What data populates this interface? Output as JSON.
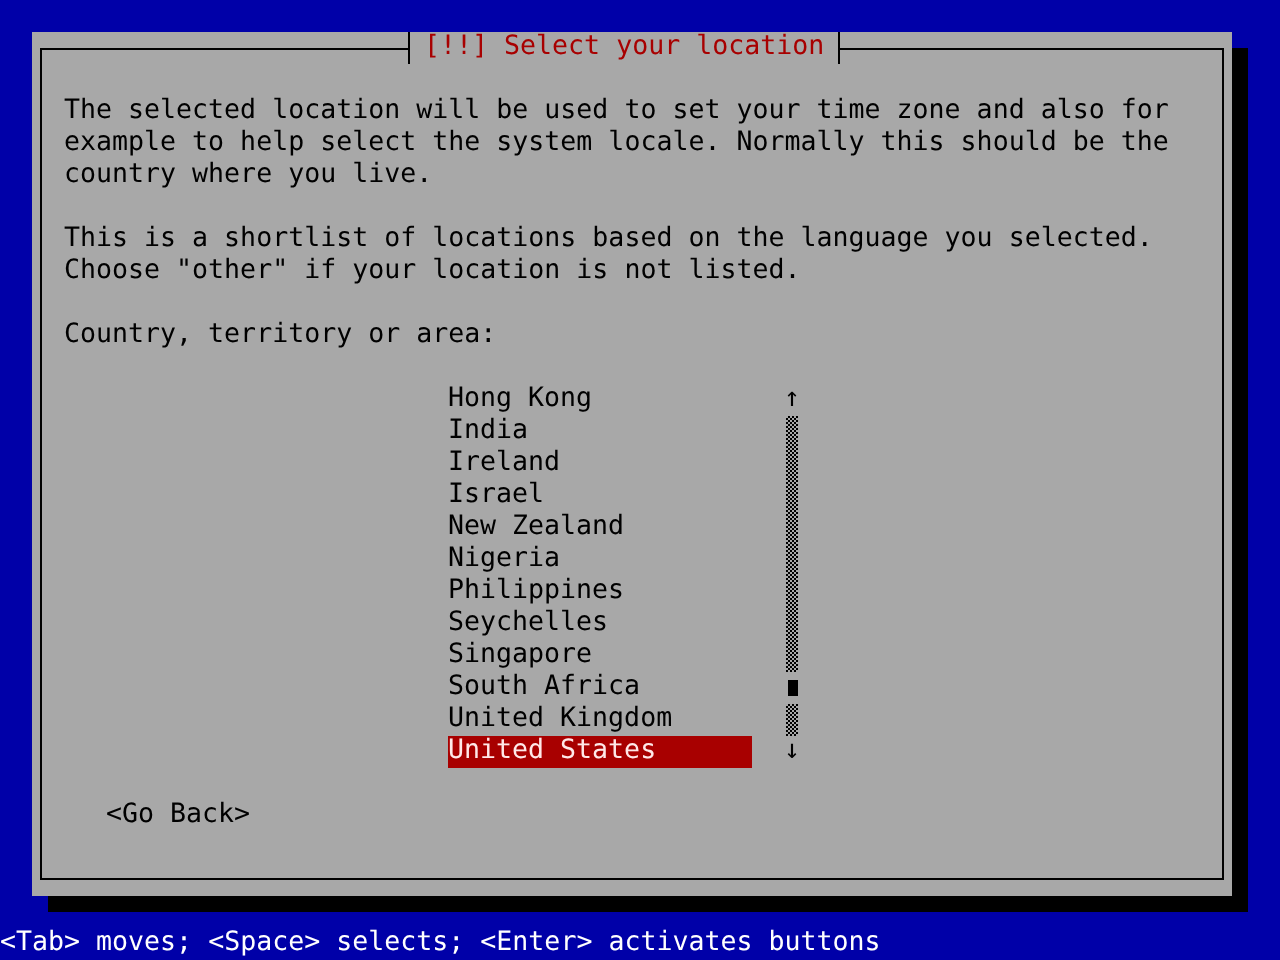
{
  "dialog": {
    "title": "[!!] Select your location",
    "paragraphs": [
      "The selected location will be used to set your time zone and also for example to help select the system locale. Normally this should be the country where you live.",
      "This is a shortlist of locations based on the language you selected. Choose \"other\" if your location is not listed."
    ],
    "list_label": "Country, territory or area:",
    "items": [
      {
        "label": "Hong Kong",
        "selected": false
      },
      {
        "label": "India",
        "selected": false
      },
      {
        "label": "Ireland",
        "selected": false
      },
      {
        "label": "Israel",
        "selected": false
      },
      {
        "label": "New Zealand",
        "selected": false
      },
      {
        "label": "Nigeria",
        "selected": false
      },
      {
        "label": "Philippines",
        "selected": false
      },
      {
        "label": "Seychelles",
        "selected": false
      },
      {
        "label": "Singapore",
        "selected": false
      },
      {
        "label": "South Africa",
        "selected": false
      },
      {
        "label": "United Kingdom",
        "selected": false
      },
      {
        "label": "United States",
        "selected": true
      }
    ],
    "scroll_up": "↑",
    "scroll_down": "↓",
    "buttons": [
      "<Go Back>"
    ]
  },
  "status_bar": "<Tab> moves; <Space> selects; <Enter> activates buttons"
}
